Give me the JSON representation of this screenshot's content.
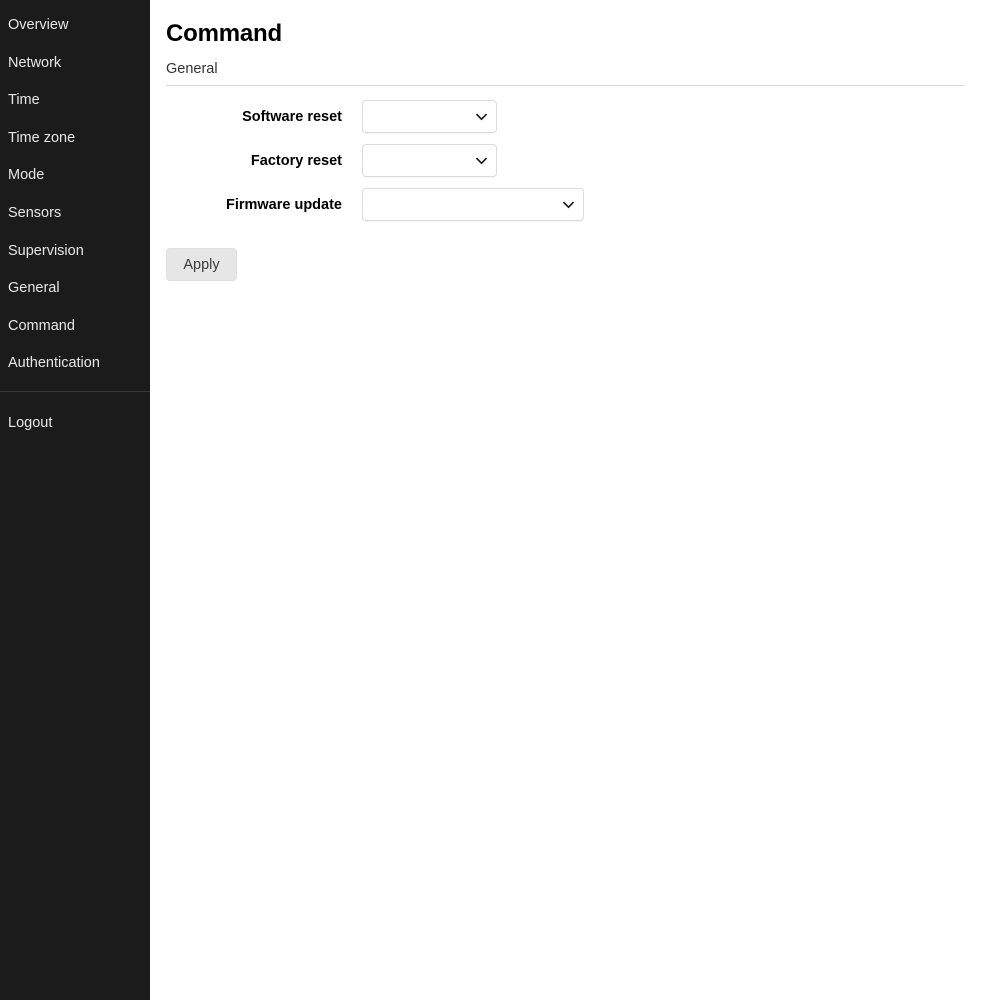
{
  "sidebar": {
    "items": [
      {
        "label": "Overview"
      },
      {
        "label": "Network"
      },
      {
        "label": "Time"
      },
      {
        "label": "Time zone"
      },
      {
        "label": "Mode"
      },
      {
        "label": "Sensors"
      },
      {
        "label": "Supervision"
      },
      {
        "label": "General"
      },
      {
        "label": "Command"
      },
      {
        "label": "Authentication"
      }
    ],
    "logout": {
      "label": "Logout"
    },
    "background_color": "#1b1b1b",
    "text_color": "#e6e6e6",
    "divider_color": "#383838"
  },
  "main": {
    "page_title": "Command",
    "section": {
      "label": "General",
      "rule_color": "#dddddd"
    },
    "fields": [
      {
        "label": "Software reset",
        "name": "software-reset",
        "value": "",
        "options": [
          ""
        ],
        "size": "small"
      },
      {
        "label": "Factory reset",
        "name": "factory-reset",
        "value": "",
        "options": [
          ""
        ],
        "size": "small"
      },
      {
        "label": "Firmware update",
        "name": "firmware-update",
        "value": "",
        "options": [
          ""
        ],
        "size": "large"
      }
    ],
    "apply_button": {
      "label": "Apply",
      "background_color": "#e6e6e6",
      "text_color": "#3a3a3a"
    }
  }
}
